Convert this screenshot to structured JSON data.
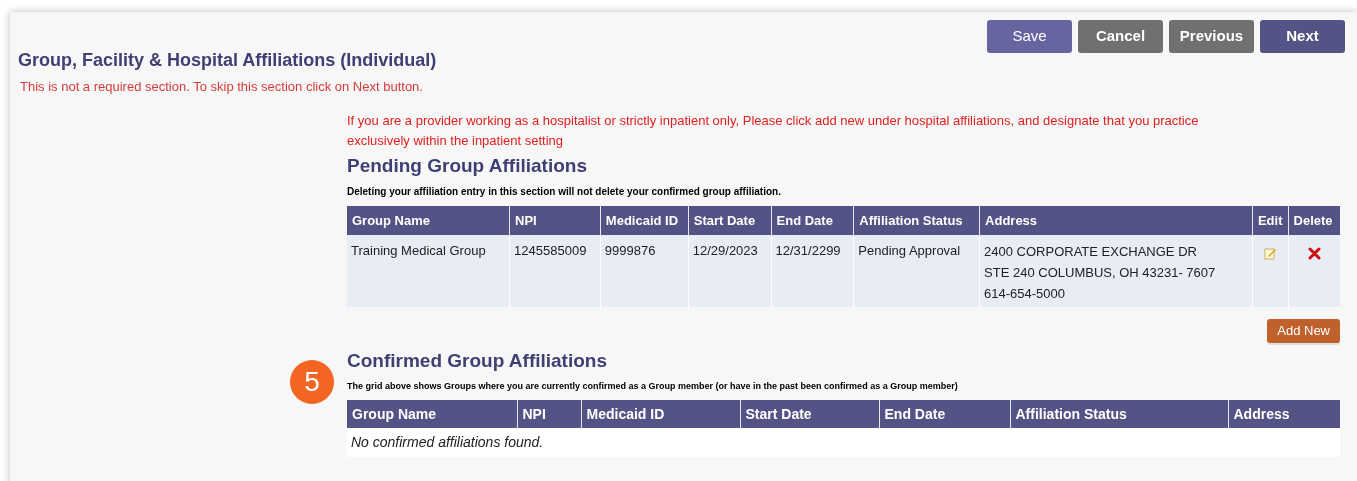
{
  "title": "Group, Facility & Hospital Affiliations (Individual)",
  "subtitle": "This is not a required section. To skip this section click on Next button.",
  "buttons": [
    {
      "label": "Save",
      "kind": "save"
    },
    {
      "label": "Cancel",
      "kind": "secondary"
    },
    {
      "label": "Previous",
      "kind": "secondary"
    },
    {
      "label": "Next",
      "kind": "primary"
    }
  ],
  "notice": "If you are a provider working as a hospitalist or strictly inpatient only, Please click add new under hospital affiliations, and designate that you practice exclusively within the inpatient setting",
  "pending": {
    "heading": "Pending Group Affiliations",
    "note": "Deleting your affiliation entry in this section will not delete your confirmed group affiliation.",
    "columns": [
      "Group Name",
      "NPI",
      "Medicaid ID",
      "Start Date",
      "End Date",
      "Affiliation Status",
      "Address",
      "Edit",
      "Delete"
    ],
    "rows": [
      {
        "group_name": "Training Medical Group",
        "npi": "1245585009",
        "medicaid_id": "9999876",
        "start_date": "12/29/2023",
        "end_date": "12/31/2299",
        "status": "Pending Approval",
        "address": [
          "2400 CORPORATE EXCHANGE DR",
          "STE 240 COLUMBUS, OH 43231- 7607",
          "614-654-5000"
        ]
      }
    ],
    "add_button": "Add New"
  },
  "step_badge": "5",
  "confirmed": {
    "heading": "Confirmed Group Affiliations",
    "note": "The grid above shows Groups where you are currently confirmed as a Group member (or have in the past been confirmed as a Group member)",
    "columns": [
      "Group Name",
      "NPI",
      "Medicaid ID",
      "Start Date",
      "End Date",
      "Affiliation Status",
      "Address"
    ],
    "empty": "No confirmed affiliations found."
  }
}
